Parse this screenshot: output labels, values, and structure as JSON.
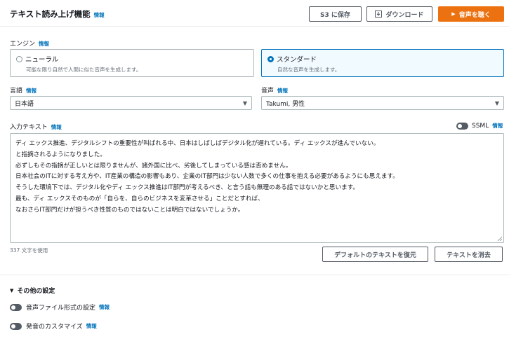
{
  "header": {
    "title": "テキスト読み上げ機能",
    "info": "情報",
    "save_s3": "S3 に保存",
    "download": "ダウンロード",
    "listen": "音声を聴く"
  },
  "engine": {
    "label": "エンジン",
    "info": "情報",
    "options": [
      {
        "title": "ニューラル",
        "desc": "可能な限り自然で人間に似た音声を生成します。",
        "selected": false
      },
      {
        "title": "スタンダード",
        "desc": "自然な音声を生成します。",
        "selected": true
      }
    ]
  },
  "language": {
    "label": "言語",
    "info": "情報",
    "value": "日本語"
  },
  "voice": {
    "label": "音声",
    "info": "情報",
    "value": "Takumi, 男性"
  },
  "input": {
    "label": "入力テキスト",
    "info": "情報",
    "ssml_label": "SSML",
    "ssml_info": "情報",
    "lines": [
      "ディ エックス推進、デジタルシフトの重要性が叫ばれる中、日本はしばしばデジタル化が遅れている。ディ エックスが進んでいない。",
      "と指摘されるようになりました。",
      "必ずしもその指摘が正しいとは限りませんが、諸外国に比べ、劣後してしまっている感は否めません。",
      "日本社会のITに対する考え方や、IT産業の構造の影響もあり、企業のIT部門は少ない人数で多くの仕事を抱える必要があるようにも思えます。",
      "そうした環境下では、デジタル化やディ エックス推進はIT部門が考えるべき、と言う話も無理のある話ではないかと思います。",
      "最も、ディ エックスそのものが「自らを、自らのビジネスを変革させる」ことだとすれば、",
      "なおさらIT部門だけが担うべき性質のものではないことは明白ではないでしょうか。"
    ],
    "char_count": "337 文字を使用",
    "restore_button": "デフォルトのテキストを復元",
    "clear_button": "テキストを消去"
  },
  "other_settings": {
    "label": "その他の設定",
    "file_format": {
      "label": "音声ファイル形式の設定",
      "info": "情報"
    },
    "customize": {
      "label": "発音のカスタマイズ",
      "info": "情報"
    }
  },
  "colors": {
    "accent": "#ec7211",
    "link": "#0073bb",
    "border": "#aab7b8"
  }
}
